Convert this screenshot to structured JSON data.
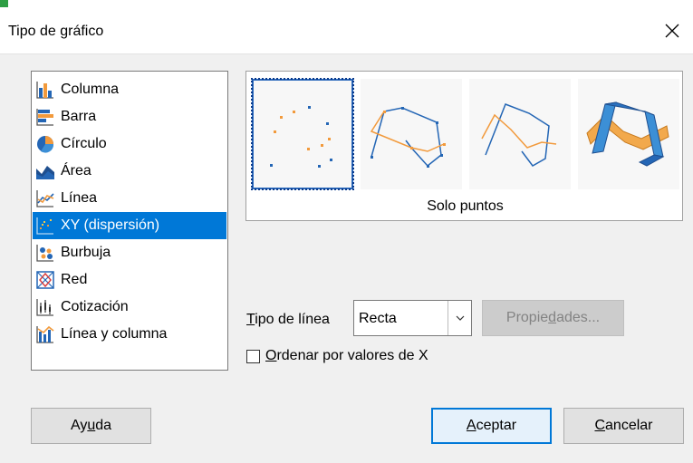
{
  "window": {
    "title": "Tipo de gráfico",
    "close_icon": "close-icon"
  },
  "chart_types": {
    "selected_index": 5,
    "items": [
      {
        "label": "Columna",
        "icon": "column-chart-icon"
      },
      {
        "label": "Barra",
        "icon": "bar-chart-icon"
      },
      {
        "label": "Círculo",
        "icon": "pie-chart-icon"
      },
      {
        "label": "Área",
        "icon": "area-chart-icon"
      },
      {
        "label": "Línea",
        "icon": "line-chart-icon"
      },
      {
        "label": "XY (dispersión)",
        "icon": "scatter-chart-icon"
      },
      {
        "label": "Burbuja",
        "icon": "bubble-chart-icon"
      },
      {
        "label": "Red",
        "icon": "net-chart-icon"
      },
      {
        "label": "Cotización",
        "icon": "stock-chart-icon"
      },
      {
        "label": "Línea y columna",
        "icon": "column-line-chart-icon"
      }
    ]
  },
  "variants": {
    "selected_label": "Solo puntos",
    "items": [
      {
        "name": "points-only",
        "icon": "points-only-icon"
      },
      {
        "name": "points-and-lines",
        "icon": "points-and-lines-icon"
      },
      {
        "name": "lines-only",
        "icon": "lines-only-icon"
      },
      {
        "name": "3d-lines",
        "icon": "3d-lines-icon"
      }
    ]
  },
  "line_type": {
    "label_mnemonic": "T",
    "label_rest": "ipo de línea",
    "value": "Recta",
    "properties_before": "Propie",
    "properties_mnemonic": "d",
    "properties_after": "ades..."
  },
  "sort_by_x": {
    "label_mnemonic": "O",
    "label_rest": "rdenar por valores de X",
    "checked": false
  },
  "buttons": {
    "help_before": "Ay",
    "help_mnemonic": "u",
    "help_after": "da",
    "ok_mnemonic": "A",
    "ok_rest": "ceptar",
    "cancel_mnemonic": "C",
    "cancel_rest": "ancelar"
  },
  "colors": {
    "selection": "#0078d7",
    "series_blue": "#2466b5",
    "series_orange": "#f29a3c"
  }
}
